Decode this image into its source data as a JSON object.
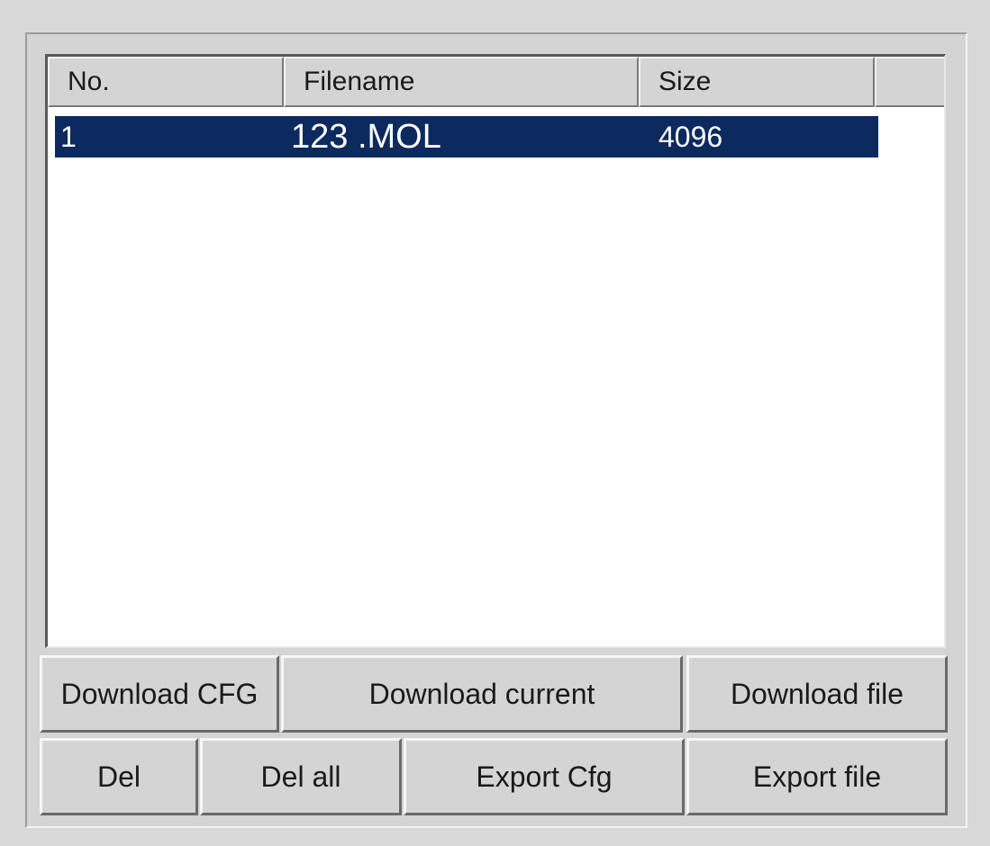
{
  "file_list": {
    "columns": [
      {
        "label": "No."
      },
      {
        "label": "Filename"
      },
      {
        "label": "Size"
      },
      {
        "label": ""
      }
    ],
    "rows": [
      {
        "no": "1",
        "filename": "123 .MOL",
        "size": "4096",
        "selected": true
      }
    ]
  },
  "buttons": {
    "download_cfg": "Download CFG",
    "download_current": "Download current",
    "download_file": "Download file",
    "del": "Del",
    "del_all": "Del all",
    "export_cfg": "Export Cfg",
    "export_file": "Export file"
  },
  "colors": {
    "selection": "#0c2a5e",
    "face": "#d4d4d4",
    "list_background": "#ffffff"
  }
}
